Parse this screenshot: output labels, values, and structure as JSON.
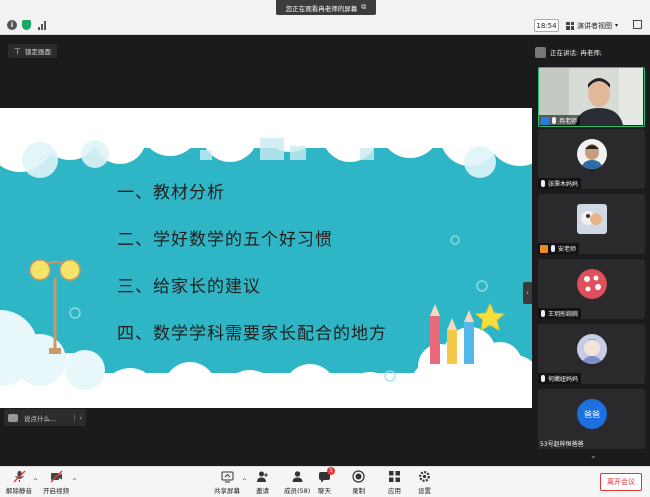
{
  "share_banner": {
    "text": "您正在观看冉老师的屏幕",
    "exit_symbol": "⧉"
  },
  "topbar": {
    "time": "18:54",
    "view_mode": "演讲者视图"
  },
  "stage": {
    "lock_label": "锁定画面",
    "slide": {
      "items": [
        "一、教材分析",
        "二、学好数学的五个好习惯",
        "三、给家长的建议",
        "四、数学学科需要家长配合的地方"
      ],
      "colors": {
        "teal": "#2fb6c6",
        "pencil_red": "#e86a7a",
        "pencil_yellow": "#f2c84b",
        "pencil_blue": "#54b8e6",
        "star": "#f7df3c"
      }
    },
    "chat_placeholder": "说点什么...",
    "chat_collapse": "‹",
    "panel_toggle": "›"
  },
  "right_panel": {
    "speaking_label": "正在讲话: 冉老师;",
    "tiles": [
      {
        "name": "冉老师",
        "role": "host",
        "kind": "video"
      },
      {
        "name": "张霈木妈妈",
        "role": "",
        "kind": "photo"
      },
      {
        "name": "安老师",
        "role": "cohost",
        "kind": "photo"
      },
      {
        "name": "王玥彤婉婉",
        "role": "",
        "kind": "photo"
      },
      {
        "name": "何嫩妞妈妈",
        "role": "",
        "kind": "photo"
      },
      {
        "name": "53号赵梓恒爸爸",
        "role": "",
        "kind": "text",
        "avatar_text": "爸爸"
      }
    ],
    "scroll_down": "⌄"
  },
  "toolbar": {
    "unmute": "解除静音",
    "start_video": "开启视频",
    "share_screen": "共享屏幕",
    "invite": "邀请",
    "members": "成员(58)",
    "chat": "聊天",
    "chat_badge": "1",
    "record": "录制",
    "apps": "应用",
    "settings": "设置",
    "leave": "离开会议",
    "caret": "^"
  }
}
